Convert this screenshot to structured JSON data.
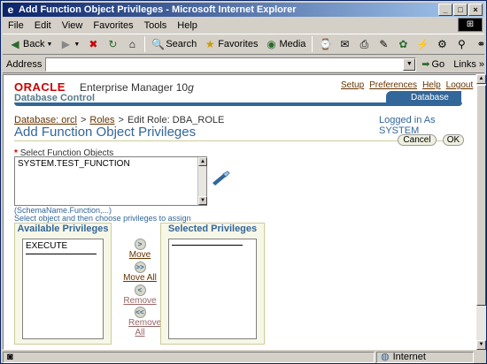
{
  "window": {
    "title": "Add Function Object Privileges - Microsoft Internet Explorer",
    "controls": [
      "_",
      "□",
      "×"
    ]
  },
  "menu": [
    "File",
    "Edit",
    "View",
    "Favorites",
    "Tools",
    "Help"
  ],
  "toolbar": {
    "back": "Back",
    "search": "Search",
    "favorites": "Favorites",
    "media": "Media"
  },
  "address": {
    "label": "Address",
    "value": "",
    "go": "Go",
    "links": "Links"
  },
  "header": {
    "oracle": "ORACLE",
    "product": "Enterprise Manager 10",
    "product_suffix": "g",
    "subtitle": "Database Control",
    "links": [
      "Setup",
      "Preferences",
      "Help",
      "Logout"
    ],
    "tab": "Database"
  },
  "breadcrumb": {
    "database": "Database: orcl",
    "sep1": ">",
    "roles": "Roles",
    "sep2": ">",
    "current": "Edit Role: DBA_ROLE"
  },
  "logged_in": "Logged in As SYSTEM",
  "page_title": "Add Function Object Privileges",
  "buttons": {
    "cancel": "Cancel",
    "ok": "OK"
  },
  "select_objects": {
    "required_mark": "*",
    "label": "Select Function Objects",
    "value": "SYSTEM.TEST_FUNCTION",
    "hint_format": "(SchemaName.Function,...)",
    "hint_instruction": "Select object and then choose privileges to assign"
  },
  "available": {
    "heading": "Available Privileges",
    "items": [
      "EXECUTE"
    ]
  },
  "selected": {
    "heading": "Selected Privileges",
    "items": []
  },
  "shuttle": {
    "move": "Move",
    "move_all": "Move All",
    "remove": "Remove",
    "remove_all": "Remove All"
  },
  "status": {
    "left": "",
    "zone": "Internet"
  }
}
